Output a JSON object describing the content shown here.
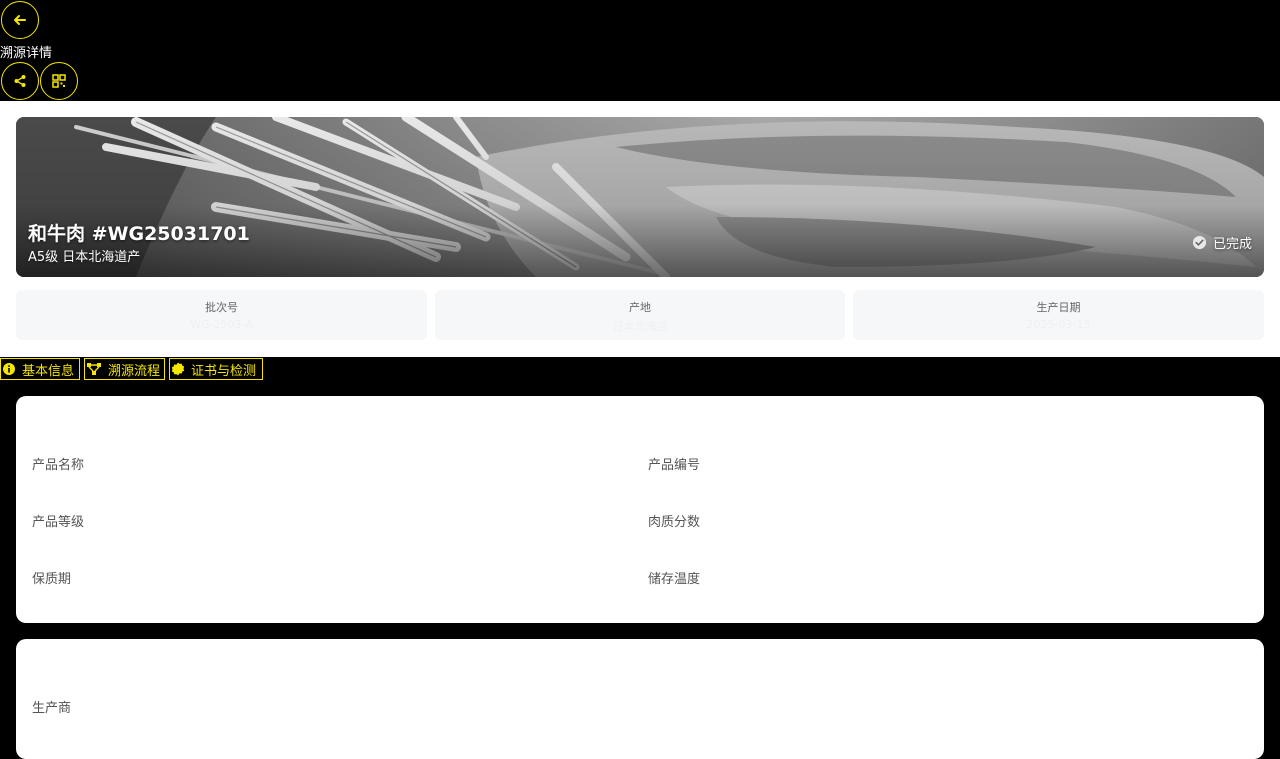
{
  "header": {
    "title": "溯源详情"
  },
  "hero": {
    "title": "和牛肉 #WG25031701",
    "subtitle": "A5级 日本北海道产",
    "status": "已完成"
  },
  "stats": [
    {
      "label": "批次号",
      "value": "WG-2503-A"
    },
    {
      "label": "产地",
      "value": "日本北海道"
    },
    {
      "label": "生产日期",
      "value": "2025-03-15"
    }
  ],
  "tabs": [
    {
      "label": "基本信息",
      "icon": "info-icon"
    },
    {
      "label": "溯源流程",
      "icon": "flow-icon"
    },
    {
      "label": "证书与检测",
      "icon": "certificate-icon"
    }
  ],
  "basic_info": {
    "fields": [
      "产品名称",
      "产品编号",
      "产品等级",
      "肉质分数",
      "保质期",
      "储存温度"
    ]
  },
  "producer": {
    "label": "生产商"
  },
  "colors": {
    "accent": "#f5e600",
    "background": "#000000",
    "card": "#ffffff"
  }
}
